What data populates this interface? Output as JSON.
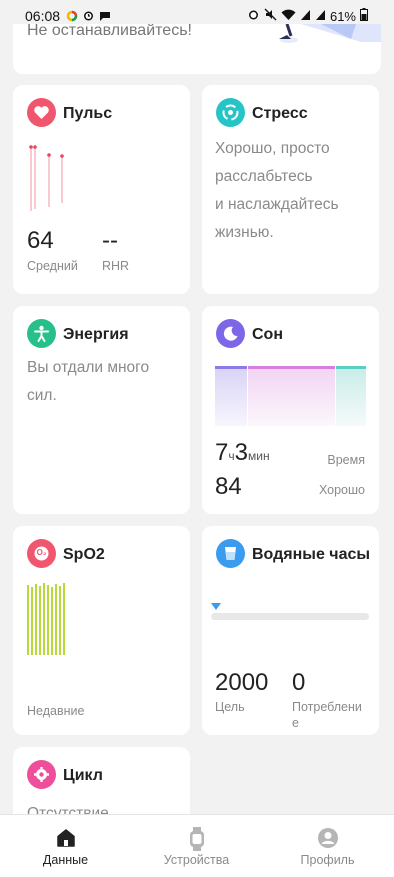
{
  "status_bar": {
    "time": "06:08",
    "battery": "61%"
  },
  "top_card": {
    "partial_text": "Не останавливайтесь!"
  },
  "pulse": {
    "title": "Пульс",
    "avg_value": "64",
    "avg_label": "Средний",
    "rhr_value": "--",
    "rhr_label": "RHR",
    "color": "#f0566e"
  },
  "stress": {
    "title": "Стресс",
    "lines": [
      "Хорошо, просто",
      "расслабьтесь",
      "и наслаждайтесь",
      "жизнью."
    ],
    "color": "#26c4c7"
  },
  "energy": {
    "title": "Энергия",
    "lines": [
      "Вы отдали много",
      "сил."
    ],
    "color": "#27c08a"
  },
  "sleep": {
    "title": "Сон",
    "hours": "7",
    "hours_unit": "ч",
    "minutes": "3",
    "minutes_unit": "мин",
    "time_label": "Время",
    "score": "84",
    "quality": "Хорошо",
    "color": "#7d66e8"
  },
  "spo2": {
    "title": "SpO2",
    "label": "Недавние",
    "color": "#f0566e",
    "icon_text": "O₂"
  },
  "water": {
    "title": "Водяные часы",
    "goal_value": "2000",
    "goal_label": "Цель",
    "consumed_value": "0",
    "consumed_label_1": "Потреблени",
    "consumed_label_2": "е",
    "color": "#3a9bef"
  },
  "cycle": {
    "title": "Цикл",
    "partial_text": "Отсутствие",
    "color": "#ef4f9a"
  },
  "nav": {
    "items": [
      {
        "label": "Данные",
        "icon": "home-icon"
      },
      {
        "label": "Устройства",
        "icon": "watch-icon"
      },
      {
        "label": "Профиль",
        "icon": "profile-icon"
      }
    ]
  }
}
